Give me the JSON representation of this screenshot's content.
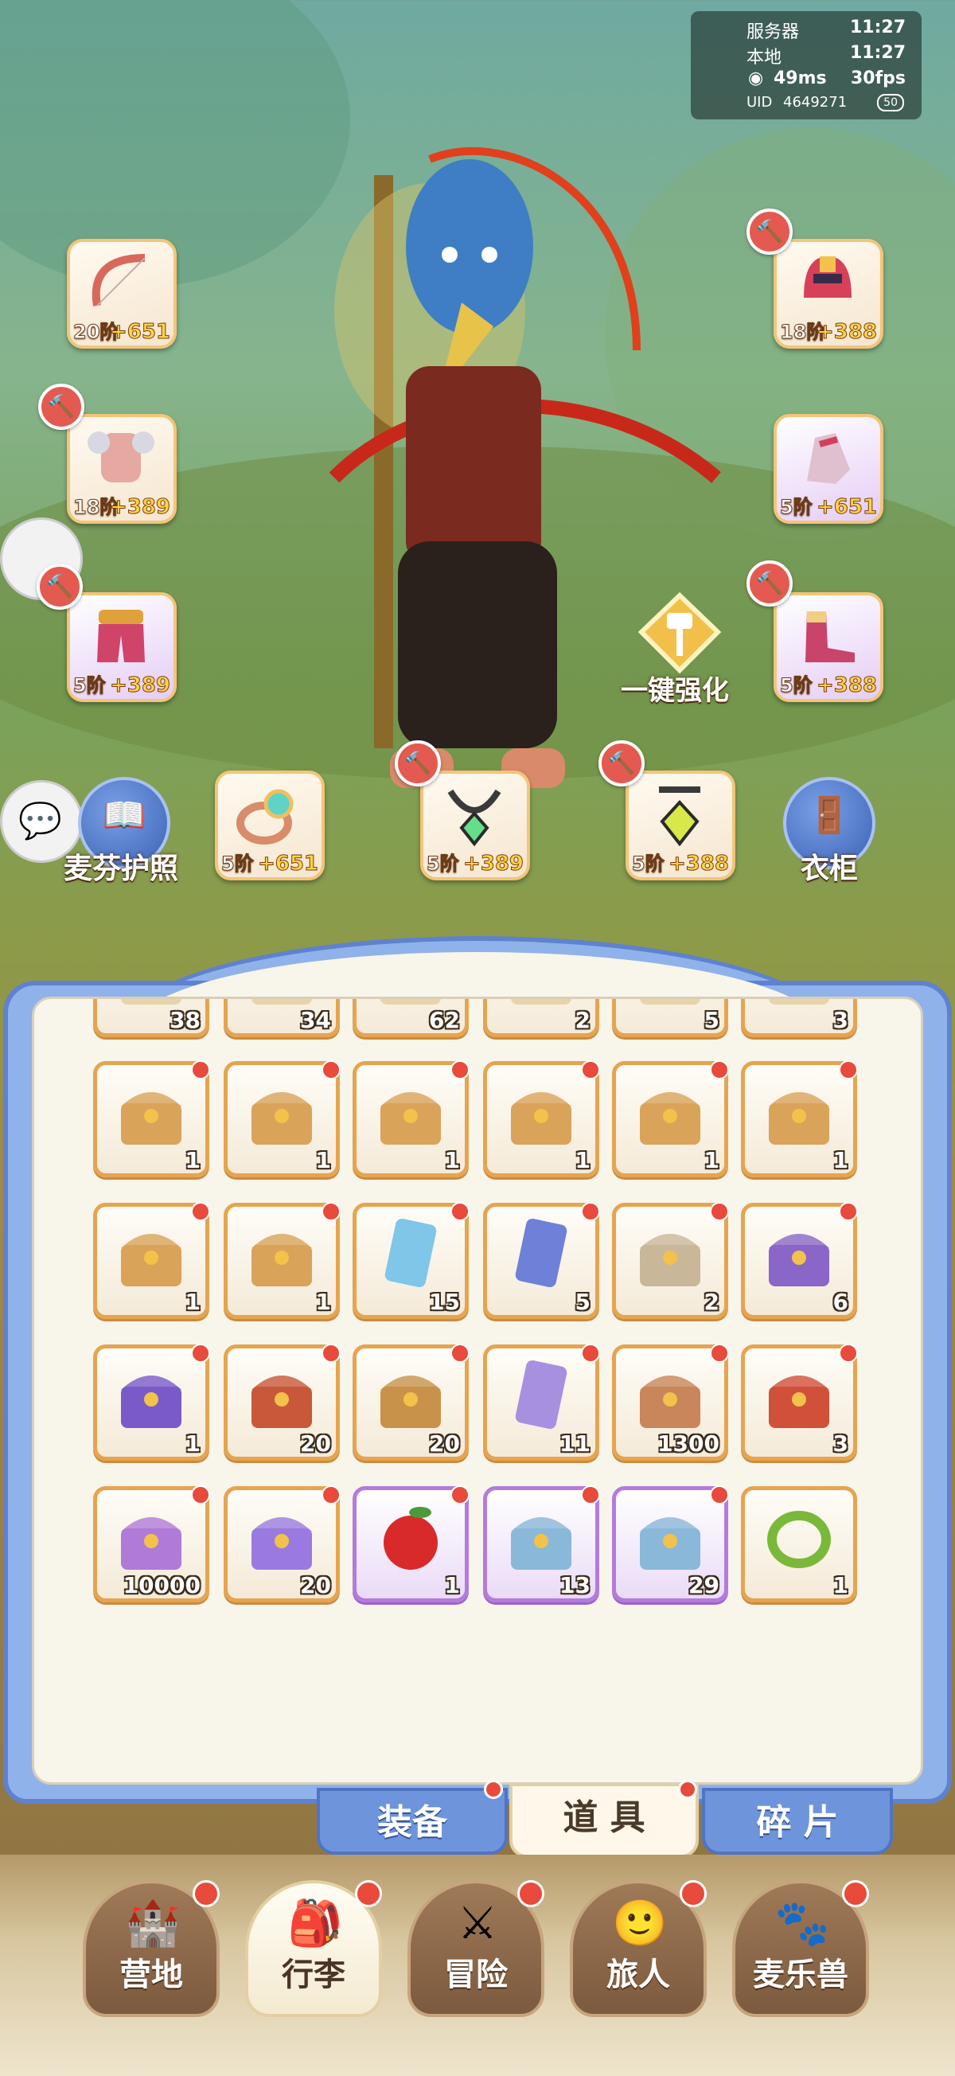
{
  "status": {
    "server_label": "服务器",
    "server_time": "11:27",
    "local_label": "本地",
    "local_time": "11:27",
    "ping": "49ms",
    "fps": "30fps",
    "uid_label": "UID",
    "uid_value": "4649271",
    "battery": "50"
  },
  "equipment": {
    "slots": [
      {
        "name": "bow",
        "level": "20阶",
        "bonus": "+651",
        "rarity": "orange"
      },
      {
        "name": "helmet",
        "level": "18阶",
        "bonus": "+388",
        "rarity": "orange"
      },
      {
        "name": "chest-armor",
        "level": "18阶",
        "bonus": "+389",
        "rarity": "orange"
      },
      {
        "name": "gloves",
        "level": "5阶",
        "bonus": "+651",
        "rarity": "purple"
      },
      {
        "name": "pants",
        "level": "5阶",
        "bonus": "+389",
        "rarity": "purple"
      },
      {
        "name": "boots",
        "level": "5阶",
        "bonus": "+388",
        "rarity": "purple"
      },
      {
        "name": "ring",
        "level": "5阶",
        "bonus": "+651",
        "rarity": "orange"
      },
      {
        "name": "necklace",
        "level": "5阶",
        "bonus": "+389",
        "rarity": "orange"
      },
      {
        "name": "amulet",
        "level": "5阶",
        "bonus": "+388",
        "rarity": "orange"
      }
    ],
    "one_click_enhance": "一键强化",
    "passport_label": "麦芬护照",
    "wardrobe_label": "衣柜"
  },
  "bag": {
    "rows": [
      [
        {
          "icon": "partial-item",
          "count": "38"
        },
        {
          "icon": "partial-item",
          "count": "34"
        },
        {
          "icon": "partial-item",
          "count": "62"
        },
        {
          "icon": "partial-item",
          "count": "2"
        },
        {
          "icon": "partial-item",
          "count": "5"
        },
        {
          "icon": "partial-item",
          "count": "3"
        }
      ],
      [
        {
          "icon": "music-bell-chest",
          "count": "1",
          "dot": true
        },
        {
          "icon": "music-bell-chest",
          "count": "1",
          "dot": true
        },
        {
          "icon": "music-bell-chest",
          "count": "1",
          "dot": true
        },
        {
          "icon": "music-bell-chest",
          "count": "1",
          "dot": true
        },
        {
          "icon": "music-bell-chest",
          "count": "1",
          "dot": true
        },
        {
          "icon": "music-bell-chest",
          "count": "1",
          "dot": true
        }
      ],
      [
        {
          "icon": "music-bell-chest",
          "count": "1",
          "dot": true
        },
        {
          "icon": "music-bell-chest",
          "count": "1",
          "dot": true
        },
        {
          "icon": "card-ticket",
          "count": "15",
          "dot": true
        },
        {
          "icon": "blue-card",
          "count": "5",
          "dot": true
        },
        {
          "icon": "gold-chest",
          "count": "2",
          "dot": true
        },
        {
          "icon": "purple-chest",
          "count": "6",
          "dot": true
        }
      ],
      [
        {
          "icon": "purple-gold-chest",
          "count": "1",
          "dot": true
        },
        {
          "icon": "red-chest",
          "count": "20",
          "dot": true
        },
        {
          "icon": "treasure-chest",
          "count": "20",
          "dot": true
        },
        {
          "icon": "letter-cards",
          "count": "11",
          "dot": true
        },
        {
          "icon": "bread-box",
          "count": "1300",
          "dot": true
        },
        {
          "icon": "red-gold-chest",
          "count": "3",
          "dot": true
        }
      ],
      [
        {
          "icon": "gem-box",
          "count": "10000",
          "dot": true
        },
        {
          "icon": "crystal-pile",
          "count": "20",
          "dot": true
        },
        {
          "icon": "apple",
          "count": "1",
          "dot": true,
          "rarity": "purple"
        },
        {
          "icon": "ice-chest",
          "count": "13",
          "dot": true,
          "rarity": "purple"
        },
        {
          "icon": "ice-chest",
          "count": "29",
          "dot": true,
          "rarity": "purple"
        },
        {
          "icon": "leaf-ring",
          "count": "1"
        }
      ]
    ]
  },
  "tabs": [
    {
      "label": "装备",
      "active": false
    },
    {
      "label": "道 具",
      "active": true
    },
    {
      "label": "碎 片",
      "active": false
    }
  ],
  "nav": [
    {
      "label": "营地",
      "icon": "castle-icon"
    },
    {
      "label": "行李",
      "icon": "backpack-icon",
      "active": true
    },
    {
      "label": "冒险",
      "icon": "crossed-swords-icon"
    },
    {
      "label": "旅人",
      "icon": "traveler-icon"
    },
    {
      "label": "麦乐兽",
      "icon": "pet-icon"
    }
  ]
}
